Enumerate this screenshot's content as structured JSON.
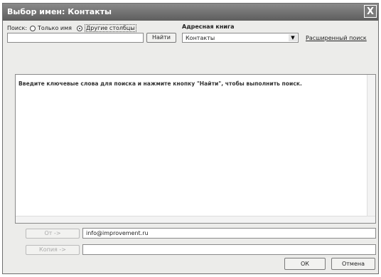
{
  "window": {
    "title": "Выбор имен: Контакты",
    "close_glyph": "X"
  },
  "search": {
    "label": "Поиск:",
    "option_name_only": "Только имя",
    "option_other_columns": "Другие столбцы",
    "selected_option": "Другие столбцы",
    "input_value": "",
    "find_button": "Найти"
  },
  "address_book": {
    "label": "Адресная книга",
    "selected": "Контакты",
    "dropdown_icon": "chevron-down-icon",
    "advanced_search": "Расширенный поиск"
  },
  "results": {
    "hint": "Введите ключевые слова для поиска и нажмите кнопку \"Найти\", чтобы выполнить поиск."
  },
  "recipients": {
    "from_button": "От ->",
    "from_value": "info@improvement.ru",
    "cc_button": "Копия ->",
    "cc_value": ""
  },
  "footer": {
    "ok_button": "ОК",
    "cancel_button": "Отмена"
  }
}
